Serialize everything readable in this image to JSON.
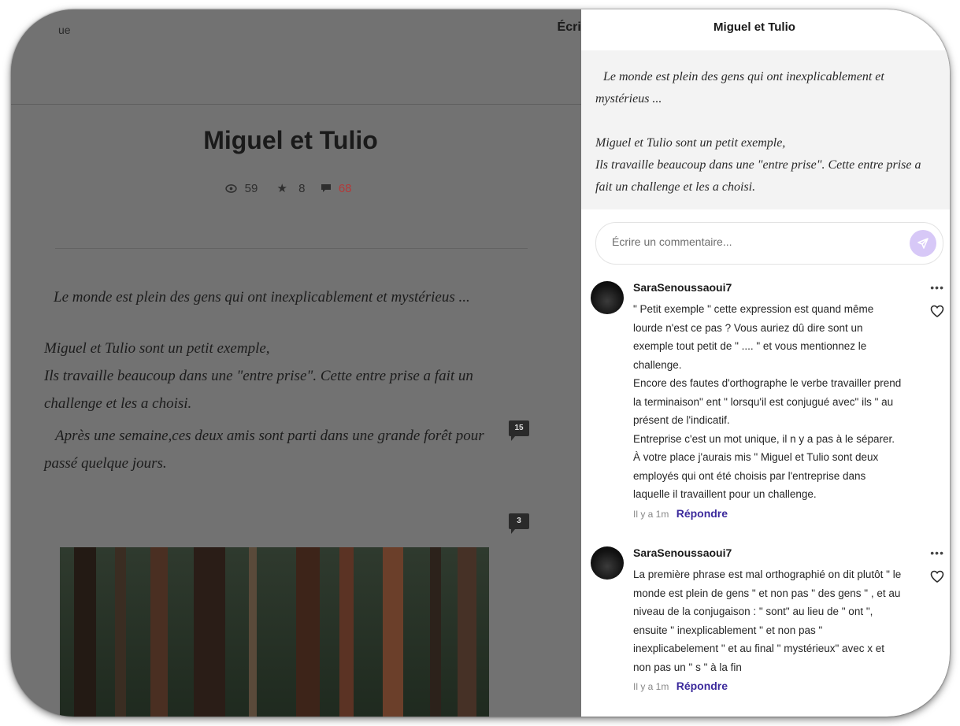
{
  "page": {
    "top_left_text": "ue",
    "top_right_text": "Écrir",
    "title": "Miguel et Tulio",
    "stats": {
      "views": "59",
      "stars": "8",
      "comments": "68"
    },
    "paragraphs": [
      "Le monde est plein des gens qui ont inexplicablement et mystérieus ...",
      "Miguel et Tulio sont un petit exemple,",
      "Ils travaille beaucoup dans une \"entre prise\". Cette entre prise a fait un challenge et les a choisi.",
      "Après une semaine,ces deux amis sont parti dans une grande forêt pour passé quelque jours."
    ],
    "inline_comment_counts": [
      "15",
      "3"
    ]
  },
  "drawer": {
    "title": "Miguel et Tulio",
    "excerpt": [
      "Le monde est plein des gens qui ont inexplicablement et mystérieus ...",
      "Miguel et Tulio sont un petit exemple,",
      "Ils travaille beaucoup dans une \"entre prise\". Cette entre prise a fait un challenge et les a choisi."
    ],
    "input_placeholder": "Écrire un commentaire...",
    "comments": [
      {
        "user": "SaraSenoussaoui7",
        "text": "\" Petit exemple \" cette expression est quand même lourde n'est ce pas ? Vous auriez dû dire sont un exemple tout petit de \" .... \" et vous mentionnez le challenge.\nEncore des fautes d'orthographe le verbe travailler prend la terminaison\" ent \" lorsqu'il est conjugué avec\" ils \" au présent de l'indicatif.\nEntreprise c'est un mot unique, il n y a pas à le séparer.\nÀ votre place j'aurais mis \" Miguel et Tulio sont deux employés qui ont été choisis par l'entreprise dans laquelle il travaillent pour un challenge.",
        "time": "Il y a 1m",
        "reply": "Répondre"
      },
      {
        "user": "SaraSenoussaoui7",
        "text": "La première phrase est mal orthographié on dit plutôt \" le monde est plein de gens \" et non pas \" des gens \" , et au niveau de la conjugaison : \" sont\" au lieu de \" ont \", ensuite \" inexplicablement \" et non pas \" inexplicabelement \" et au final \" mystérieux\" avec x et non pas un \" s \" à la fin",
        "time": "Il y a 1m",
        "reply": "Répondre"
      }
    ]
  },
  "colors": {
    "accent": "#3c2a9c",
    "send_button": "#d7c8f7",
    "comment_count": "#b23a3a"
  }
}
